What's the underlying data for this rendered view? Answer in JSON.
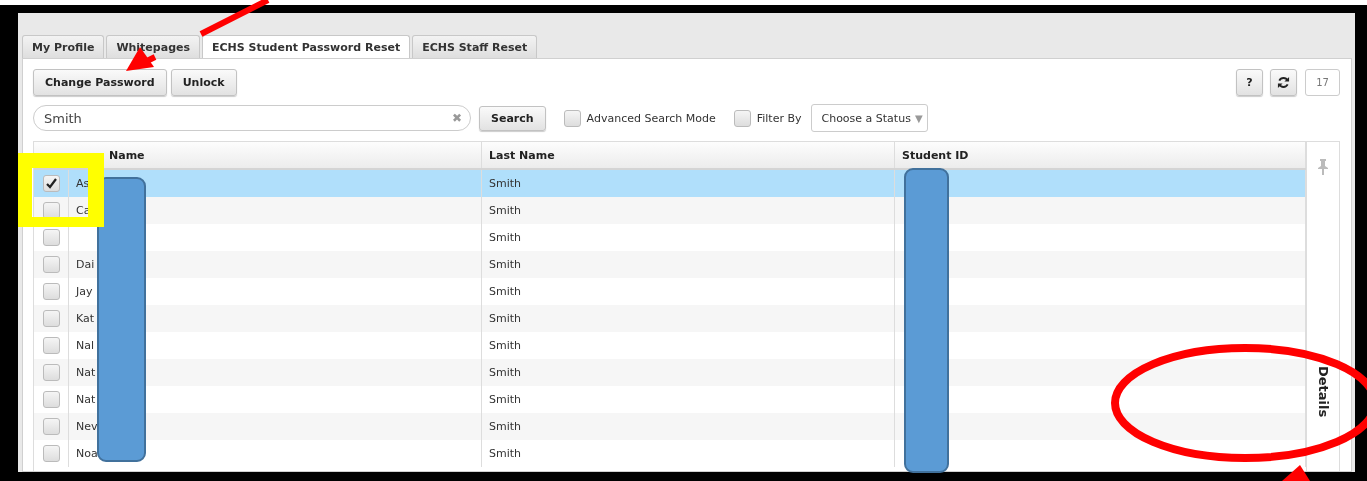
{
  "tabs": [
    {
      "label": "My Profile",
      "selected": false
    },
    {
      "label": "Whitepages",
      "selected": false
    },
    {
      "label": "ECHS Student Password Reset",
      "selected": true
    },
    {
      "label": "ECHS Staff Reset",
      "selected": false
    }
  ],
  "actions": [
    "Change Password",
    "Unlock"
  ],
  "tools": {
    "help": "?",
    "count": "17"
  },
  "search": {
    "value": "Smith",
    "clear": "✖",
    "button": "Search"
  },
  "options": [
    {
      "label": "Advanced Search Mode",
      "checked": false
    },
    {
      "label": "Filter By",
      "checked": false
    }
  ],
  "status_select": {
    "placeholder": "Choose a Status",
    "caret": "▼"
  },
  "table": {
    "columns": [
      "Name",
      "Last Name",
      "Student ID"
    ],
    "rows": [
      {
        "first": "As",
        "last": "Smith",
        "checked": true,
        "selected": true
      },
      {
        "first": "Ca",
        "last": "Smith",
        "checked": false,
        "selected": false
      },
      {
        "last": "Smith",
        "checked": false,
        "selected": false
      },
      {
        "first": "Dai",
        "last": "Smith",
        "checked": false,
        "selected": false
      },
      {
        "first": "Jay",
        "last": "Smith",
        "checked": false,
        "selected": false
      },
      {
        "first": "Kat",
        "last": "Smith",
        "checked": false,
        "selected": false
      },
      {
        "first": "Nal",
        "last": "Smith",
        "checked": false,
        "selected": false
      },
      {
        "first": "Nat",
        "last": "Smith",
        "checked": false,
        "selected": false
      },
      {
        "first": "Nat",
        "last": "Smith",
        "checked": false,
        "selected": false
      },
      {
        "first": "Nev",
        "last": "Smith",
        "checked": false,
        "selected": false
      },
      {
        "first": "Noa",
        "last": "Smith",
        "checked": false,
        "selected": false
      }
    ]
  },
  "side_panel": {
    "label": "Details"
  }
}
